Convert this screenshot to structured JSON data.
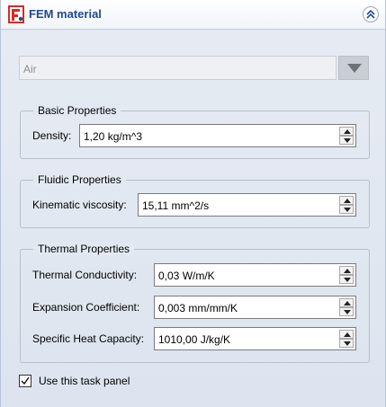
{
  "header": {
    "title": "FEM material"
  },
  "material": {
    "selected": "Air"
  },
  "basic": {
    "title": "Basic Properties",
    "density_label": "Density:",
    "density_value": "1,20 kg/m^3"
  },
  "fluidic": {
    "title": "Fluidic Properties",
    "viscosity_label": "Kinematic viscosity:",
    "viscosity_value": "15,11 mm^2/s"
  },
  "thermal": {
    "title": "Thermal Properties",
    "conductivity_label": "Thermal Conductivity:",
    "conductivity_value": "0,03 W/m/K",
    "expansion_label": "Expansion Coefficient:",
    "expansion_value": "0,003 mm/mm/K",
    "heat_label": "Specific Heat Capacity:",
    "heat_value": "1010,00 J/kg/K"
  },
  "footer": {
    "use_panel_label": "Use this task panel",
    "use_panel_checked": true
  },
  "colors": {
    "title": "#1f4a8f",
    "logo_red": "#d62b26"
  }
}
